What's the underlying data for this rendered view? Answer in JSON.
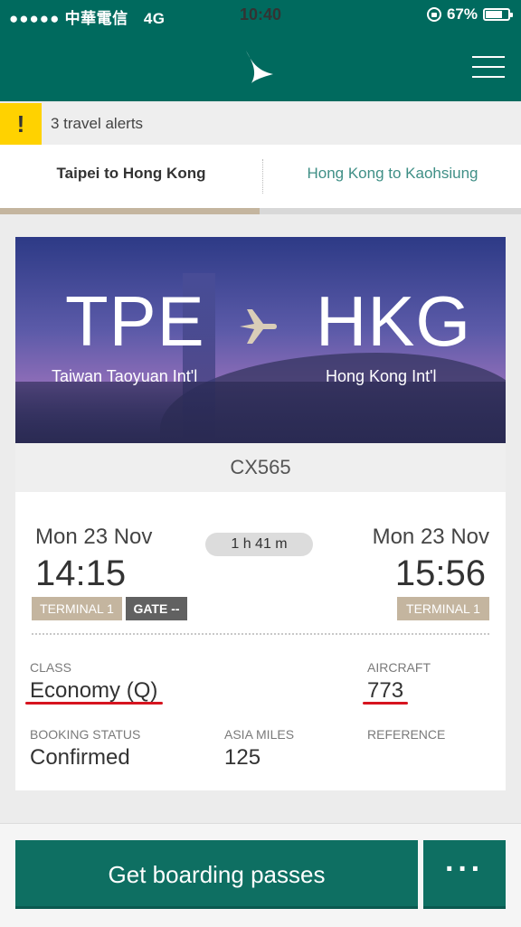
{
  "status_bar": {
    "signal": "●●●●●",
    "carrier": "中華電信",
    "network": "4G",
    "time": "10:40",
    "battery": "67%"
  },
  "header": {
    "logo_icon": "cathay-brushwing-logo-icon",
    "menu_icon": "hamburger-menu-icon"
  },
  "alerts": {
    "icon": "!",
    "text": "3 travel alerts"
  },
  "tabs": [
    {
      "label": "Taipei to Hong Kong",
      "active": true
    },
    {
      "label": "Hong Kong to Kaohsiung",
      "active": false
    }
  ],
  "flight": {
    "from_code": "TPE",
    "from_name": "Taiwan Taoyuan Int'l",
    "to_code": "HKG",
    "to_name": "Hong Kong Int'l",
    "number": "CX565",
    "depart_date": "Mon 23 Nov",
    "depart_time": "14:15",
    "duration": "1 h 41 m",
    "arrive_date": "Mon 23 Nov",
    "arrive_time": "15:56",
    "depart_terminal": "TERMINAL 1",
    "gate": "GATE --",
    "arrive_terminal": "TERMINAL 1"
  },
  "details": {
    "class_label": "CLASS",
    "class_value": "Economy (Q)",
    "aircraft_label": "AIRCRAFT",
    "aircraft_value": "773",
    "booking_label": "BOOKING STATUS",
    "booking_value": "Confirmed",
    "miles_label": "ASIA MILES",
    "miles_value": "125",
    "reference_label": "REFERENCE"
  },
  "actions": {
    "primary": "Get boarding passes",
    "more": "···"
  },
  "colors": {
    "brand_green": "#006a5e",
    "button_green": "#0e6f62",
    "accent_gold": "#c4b59f",
    "alert_yellow": "#ffd200",
    "underline_red": "#d6141f"
  }
}
